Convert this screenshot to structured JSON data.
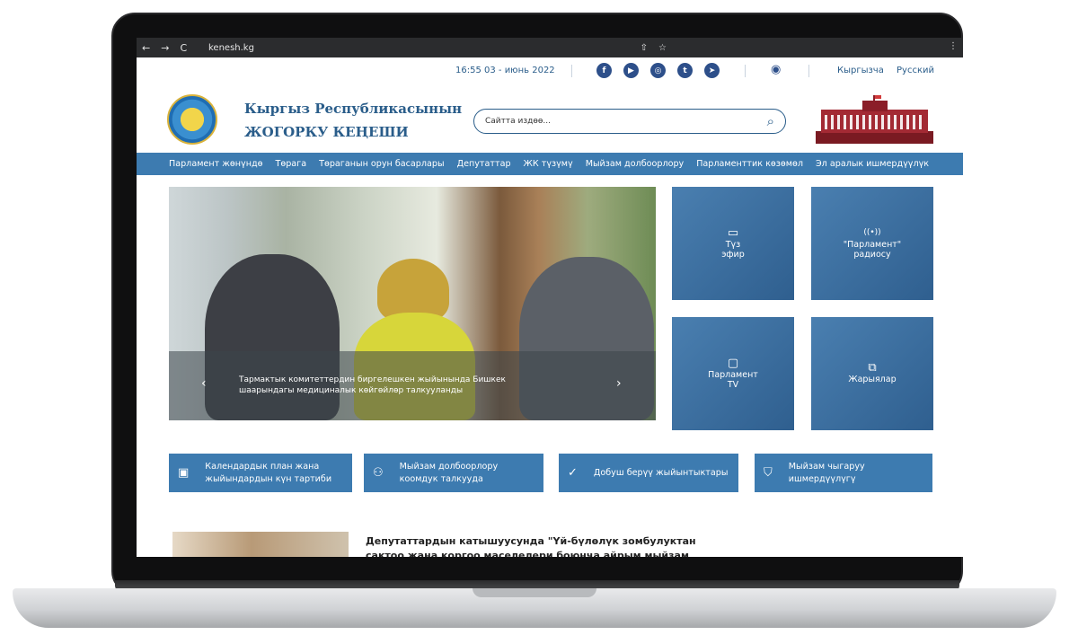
{
  "browser": {
    "url": "kenesh.kg",
    "back": "←",
    "forward": "→",
    "reload": "C",
    "share": "⇧",
    "star": "☆",
    "menu": "⋮"
  },
  "topbar": {
    "datetime": "16:55 03 - июнь 2022",
    "socials": [
      {
        "icon": "facebook-icon",
        "glyph": "f"
      },
      {
        "icon": "youtube-icon",
        "glyph": "▶"
      },
      {
        "icon": "instagram-icon",
        "glyph": "◎"
      },
      {
        "icon": "twitter-icon",
        "glyph": "t"
      },
      {
        "icon": "telegram-icon",
        "glyph": "➤"
      }
    ],
    "accessibility_icon": "eye-icon",
    "languages": [
      "Кыргызча",
      "Русский"
    ]
  },
  "header": {
    "title_line1": "Кыргыз Республикасынын",
    "title_line2": "ЖОГОРКУ КЕҢЕШИ",
    "search_placeholder": "Сайтта издөө..."
  },
  "menu": [
    "Парламент жөнүндө",
    "Төрага",
    "Төраганын орун басарлары",
    "Депутаттар",
    "ЖК түзүмү",
    "Мыйзам долбоорлору",
    "Парламенттик көзөмөл",
    "Эл аралык ишмердүүлүк"
  ],
  "hero": {
    "caption": "Тармактык комитеттердин биргелешкен жыйынында Бишкек шаарындагы медициналык көйгөйлөр талкууланды",
    "prev": "‹",
    "next": "›"
  },
  "tiles": [
    {
      "icon": "video-camera-icon",
      "glyph": "▭",
      "line1": "Түз",
      "line2": "эфир"
    },
    {
      "icon": "radio-icon",
      "glyph": "((•))",
      "line1": "\"Парламент\"",
      "line2": "радиосу"
    },
    {
      "icon": "tv-icon",
      "glyph": "▢",
      "line1": "Парламент",
      "line2": "TV"
    },
    {
      "icon": "book-icon",
      "glyph": "⧉",
      "line1": "Жарыялар",
      "line2": ""
    }
  ],
  "services": [
    {
      "icon": "calendar-icon",
      "glyph": "▣",
      "line1": "Календардык план жана",
      "line2": "жыйындардын күн тартиби"
    },
    {
      "icon": "users-icon",
      "glyph": "⚇",
      "line1": "Мыйзам долбоорлору",
      "line2": "коомдук талкууда"
    },
    {
      "icon": "check-circle-icon",
      "glyph": "✓",
      "line1": "Добуш берүү жыйынтыктары",
      "line2": ""
    },
    {
      "icon": "shield-icon",
      "glyph": "⛉",
      "line1": "Мыйзам чыгаруу",
      "line2": "ишмердүүлүгү"
    }
  ],
  "news": {
    "title": "Депутаттардын катышуусунда \"Үй-бүлөлүк зомбулуктан сактоо жана коргоо маселелери боюнча айрым мыйзам актыларына"
  },
  "colors": {
    "primary": "#3d7bb0",
    "text_blue": "#2a5d8a",
    "social": "#2d4f8a"
  }
}
